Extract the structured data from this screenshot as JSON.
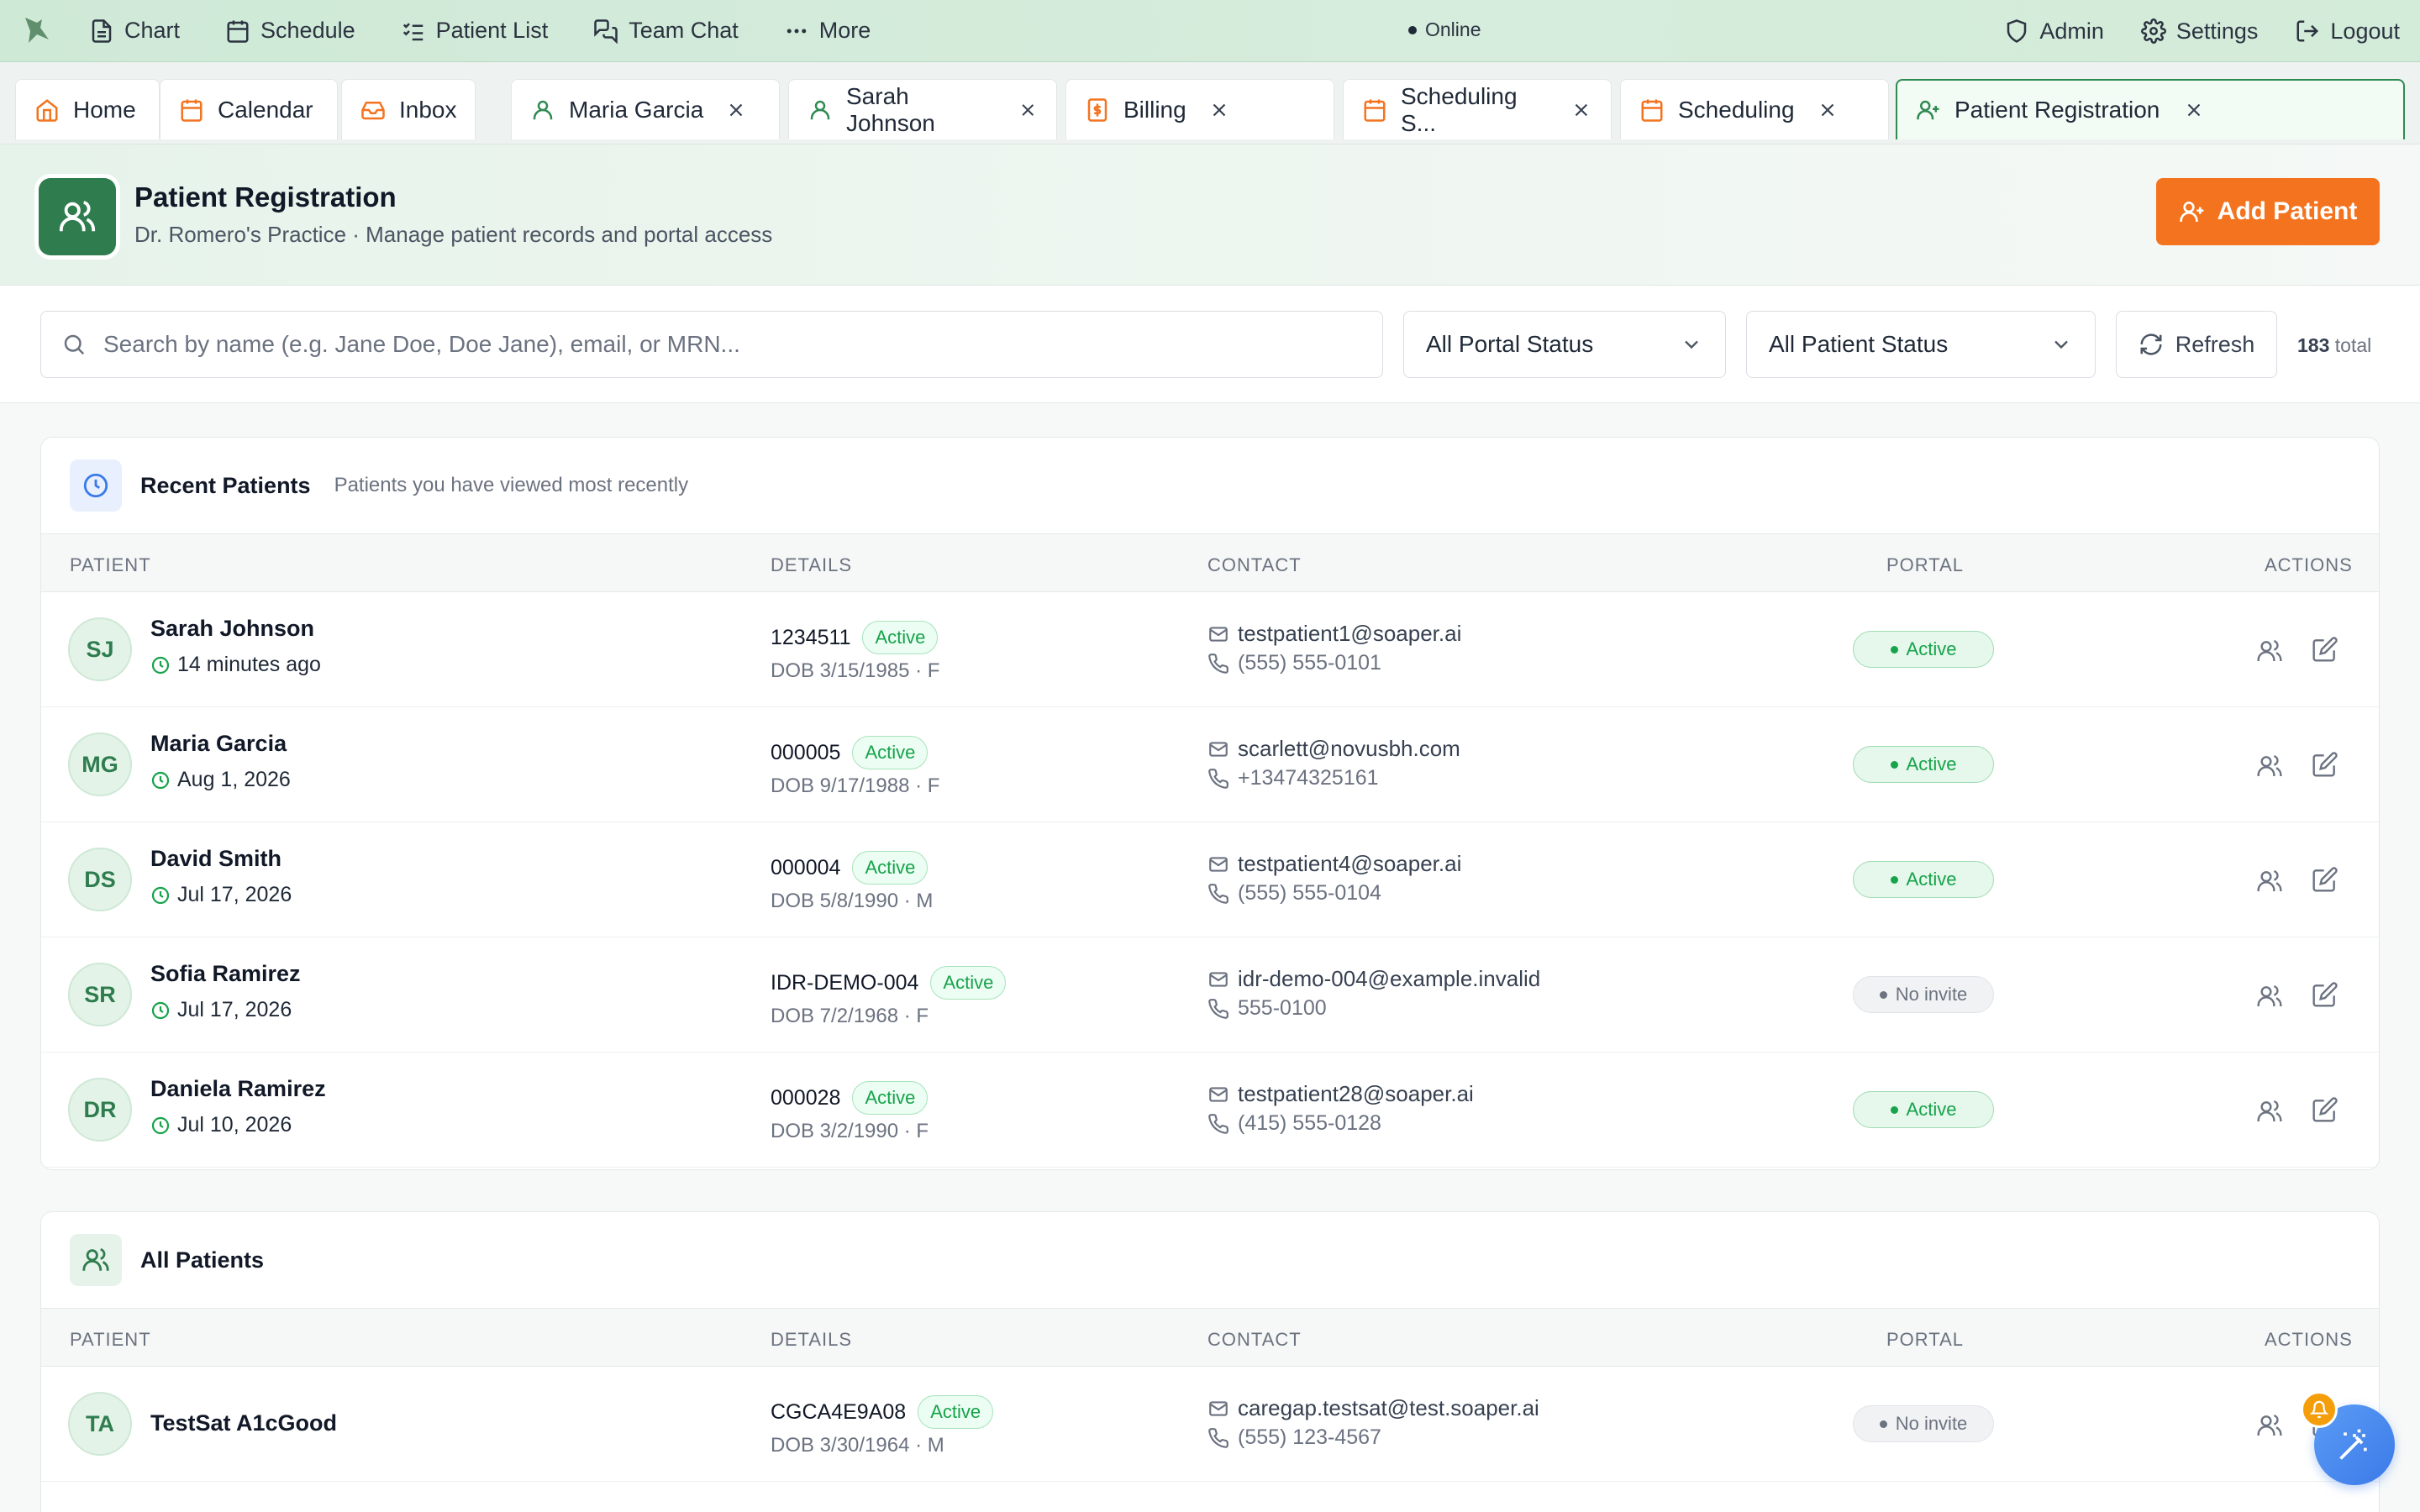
{
  "topnav": {
    "items": [
      {
        "label": "Chart",
        "icon": "document-icon"
      },
      {
        "label": "Schedule",
        "icon": "calendar-icon"
      },
      {
        "label": "Patient List",
        "icon": "list-check-icon"
      },
      {
        "label": "Team Chat",
        "icon": "chat-icon"
      },
      {
        "label": "More",
        "icon": "ellipsis-icon"
      }
    ],
    "status": "Online",
    "right": [
      {
        "label": "Admin",
        "icon": "shield-icon"
      },
      {
        "label": "Settings",
        "icon": "gear-icon"
      },
      {
        "label": "Logout",
        "icon": "logout-icon"
      }
    ]
  },
  "tabs": [
    {
      "label": "Home",
      "icon": "home-icon",
      "closable": false
    },
    {
      "label": "Calendar",
      "icon": "calendar-icon",
      "closable": false
    },
    {
      "label": "Inbox",
      "icon": "inbox-icon",
      "closable": false
    },
    {
      "label": "Maria Garcia",
      "icon": "user-icon",
      "closable": true
    },
    {
      "label": "Sarah Johnson",
      "icon": "user-icon",
      "closable": true
    },
    {
      "label": "Billing",
      "icon": "billing-icon",
      "closable": true
    },
    {
      "label": "Scheduling S...",
      "icon": "calendar-icon",
      "closable": true
    },
    {
      "label": "Scheduling",
      "icon": "calendar-icon",
      "closable": true
    },
    {
      "label": "Patient Registration",
      "icon": "user-plus-icon",
      "closable": true,
      "active": true
    }
  ],
  "header": {
    "title": "Patient Registration",
    "subtitle": "Dr. Romero's Practice · Manage patient records and portal access",
    "add_button": "Add Patient"
  },
  "filters": {
    "search_placeholder": "Search by name (e.g. Jane Doe, Doe Jane), email, or MRN...",
    "portal_status": "All Portal Status",
    "patient_status": "All Patient Status",
    "refresh": "Refresh",
    "total_count": "183",
    "total_label": "total"
  },
  "columns": {
    "patient": "PATIENT",
    "details": "DETAILS",
    "contact": "CONTACT",
    "portal": "PORTAL",
    "actions": "ACTIONS"
  },
  "recent": {
    "title": "Recent Patients",
    "subtitle": "Patients you have viewed most recently",
    "rows": [
      {
        "initials": "SJ",
        "name": "Sarah Johnson",
        "time": "14 minutes ago",
        "mrn": "1234511",
        "status": "Active",
        "dob": "DOB 3/15/1985 · F",
        "email": "testpatient1@soaper.ai",
        "phone": "(555) 555-0101",
        "portal": "Active",
        "portal_state": "active"
      },
      {
        "initials": "MG",
        "name": "Maria Garcia",
        "time": "Aug 1, 2026",
        "mrn": "000005",
        "status": "Active",
        "dob": "DOB 9/17/1988 · F",
        "email": "scarlett@novusbh.com",
        "phone": "+13474325161",
        "portal": "Active",
        "portal_state": "active"
      },
      {
        "initials": "DS",
        "name": "David Smith",
        "time": "Jul 17, 2026",
        "mrn": "000004",
        "status": "Active",
        "dob": "DOB 5/8/1990 · M",
        "email": "testpatient4@soaper.ai",
        "phone": "(555) 555-0104",
        "portal": "Active",
        "portal_state": "active"
      },
      {
        "initials": "SR",
        "name": "Sofia Ramirez",
        "time": "Jul 17, 2026",
        "mrn": "IDR-DEMO-004",
        "status": "Active",
        "dob": "DOB 7/2/1968 · F",
        "email": "idr-demo-004@example.invalid",
        "phone": "555-0100",
        "portal": "No invite",
        "portal_state": "none"
      },
      {
        "initials": "DR",
        "name": "Daniela Ramirez",
        "time": "Jul 10, 2026",
        "mrn": "000028",
        "status": "Active",
        "dob": "DOB 3/2/1990 · F",
        "email": "testpatient28@soaper.ai",
        "phone": "(415) 555-0128",
        "portal": "Active",
        "portal_state": "active"
      }
    ]
  },
  "all": {
    "title": "All Patients",
    "rows": [
      {
        "initials": "TA",
        "name": "TestSat A1cGood",
        "mrn": "CGCA4E9A08",
        "status": "Active",
        "dob": "DOB 3/30/1964 · M",
        "email": "caregap.testsat@test.soaper.ai",
        "phone": "(555) 123-4567",
        "portal": "No invite",
        "portal_state": "none"
      }
    ]
  },
  "colors": {
    "brand_green": "#2f7d4f",
    "accent_orange": "#f4731f",
    "status_green": "#16a34a"
  }
}
